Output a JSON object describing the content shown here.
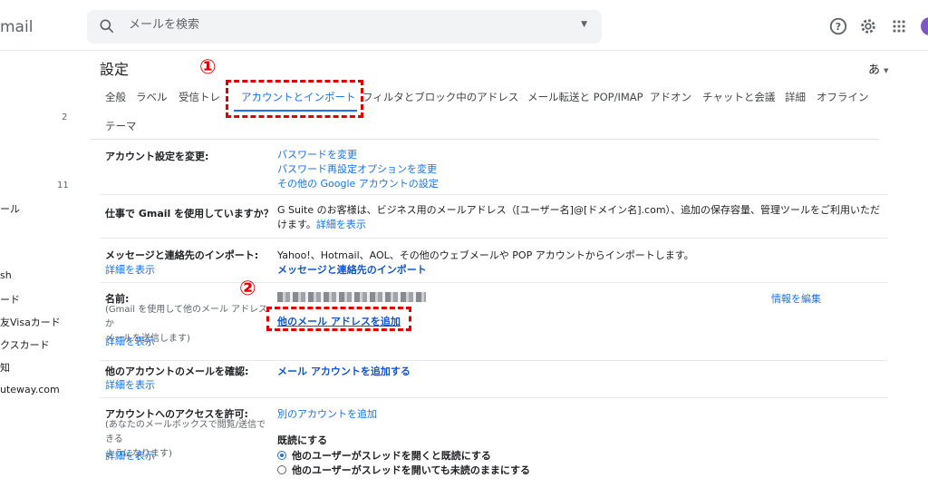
{
  "app": {
    "title": "mail"
  },
  "search": {
    "placeholder": "メールを検索"
  },
  "sidebar": {
    "items": [
      {
        "label": "ール",
        "top": 0
      },
      {
        "label": "sh"
      },
      {
        "label": "ード"
      },
      {
        "label": "友Visaカード"
      },
      {
        "label": "クスカード"
      },
      {
        "label": "知"
      },
      {
        "label": "uteway.com"
      }
    ],
    "counts": [
      "2",
      "11"
    ]
  },
  "settings": {
    "title": "設定",
    "ime": "あ"
  },
  "tabs": [
    "全般",
    "ラベル",
    "受信トレ",
    "アカウントとインポート",
    "フィルタとブロック中のアドレス",
    "メール転送と POP/IMAP",
    "アドオン",
    "チャットと会議",
    "詳細",
    "オフライン",
    "テーマ"
  ],
  "annotations": {
    "one": "①",
    "two": "②"
  },
  "rows": {
    "account": {
      "label": "アカウント設定を変更:",
      "links": [
        "パスワードを変更",
        "パスワード再設定オプションを変更",
        "その他の Google アカウントの設定"
      ]
    },
    "gsuite": {
      "label": "仕事で Gmail を使用していますか？",
      "text_line1": "G Suite のお客様は、ビジネス用のメールアドレス（[ユーザー名]@[ドメイン名].com）、追加の保存容量、管理ツールをご利用いただ",
      "text_line2": "けます。",
      "more": "詳細を表示"
    },
    "import": {
      "label": "メッセージと連絡先のインポート:",
      "detail": "詳細を表示",
      "text": "Yahoo!、Hotmail、AOL、その他のウェブメールや POP アカウントからインポートします。",
      "link": "メッセージと連絡先のインポート"
    },
    "name": {
      "label": "名前:",
      "sub_line1": "(Gmail を使用して他のメール アドレスか",
      "sub_line2": "メールを送信します)",
      "detail": "詳細を表示",
      "add_link": "他のメール アドレスを追加",
      "edit": "情報を編集"
    },
    "check": {
      "label": "他のアカウントのメールを確認:",
      "detail": "詳細を表示",
      "link": "メール アカウントを追加する"
    },
    "access": {
      "label": "アカウントへのアクセスを許可:",
      "sub_line1": "(あなたのメールボックスで閲覧/送信できる",
      "sub_line2": "ようになります)",
      "detail": "詳細を表示",
      "link": "別のアカウントを追加",
      "read_label": "既読にする",
      "option1": "他のユーザーがスレッドを開くと既読にする",
      "option2": "他のユーザーがスレッドを開いても未読のままにする",
      "selected": 1
    }
  },
  "colors": {
    "accent": "#1a73e8",
    "annotation": "#e00000"
  }
}
